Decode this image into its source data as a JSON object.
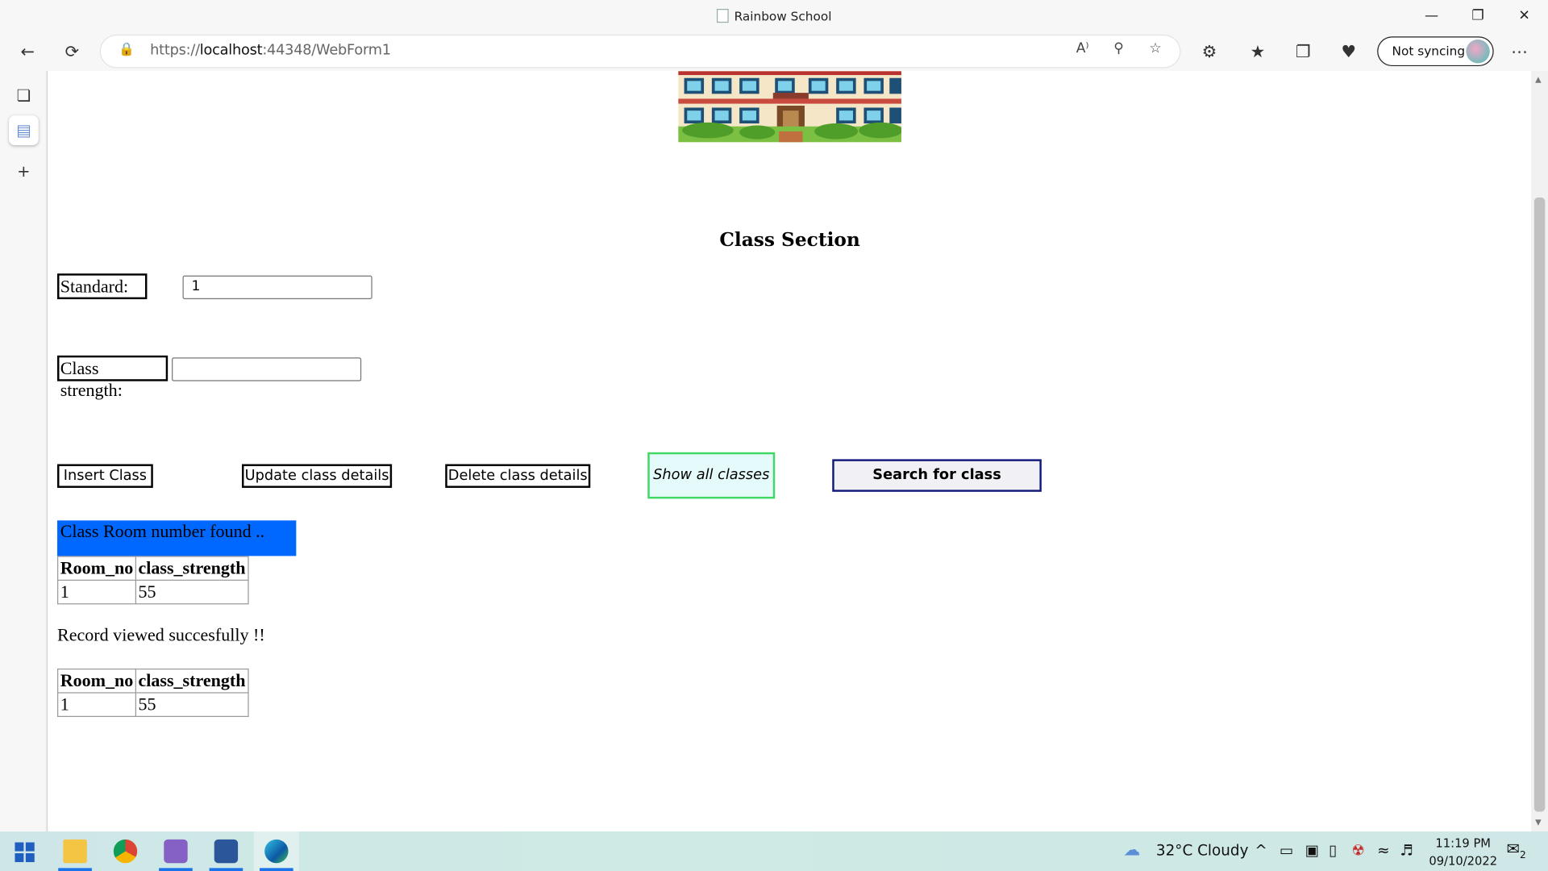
{
  "window": {
    "title": "Rainbow School"
  },
  "browser": {
    "url_prefix": "https://",
    "url_host": "localhost",
    "url_rest": ":44348/WebForm1",
    "sync_label": "Not syncing"
  },
  "page": {
    "heading": "Class Section",
    "form": {
      "standard_label": "Standard:",
      "standard_value": "1",
      "strength_label": "Class strength:",
      "strength_value": ""
    },
    "buttons": {
      "insert": "Insert Class",
      "update": "Update class details",
      "delete": "Delete class details",
      "show_all": "Show all classes",
      "search": "Search for class"
    },
    "found_message": "Class Room number found ..",
    "viewed_message": "Record viewed succesfully !!",
    "table1": {
      "headers": [
        "Room_no",
        "class_strength"
      ],
      "rows": [
        [
          "1",
          "55"
        ]
      ]
    },
    "table2": {
      "headers": [
        "Room_no",
        "class_strength"
      ],
      "rows": [
        [
          "1",
          "55"
        ]
      ]
    }
  },
  "taskbar": {
    "weather": "32°C  Cloudy",
    "time": "11:19 PM",
    "date": "09/10/2022",
    "notification_count": "2"
  },
  "colors": {
    "found_banner": "#0067ff",
    "show_all_border": "#3ed862",
    "search_border": "#111a7a",
    "taskbar_accent": "#1a73e8"
  }
}
